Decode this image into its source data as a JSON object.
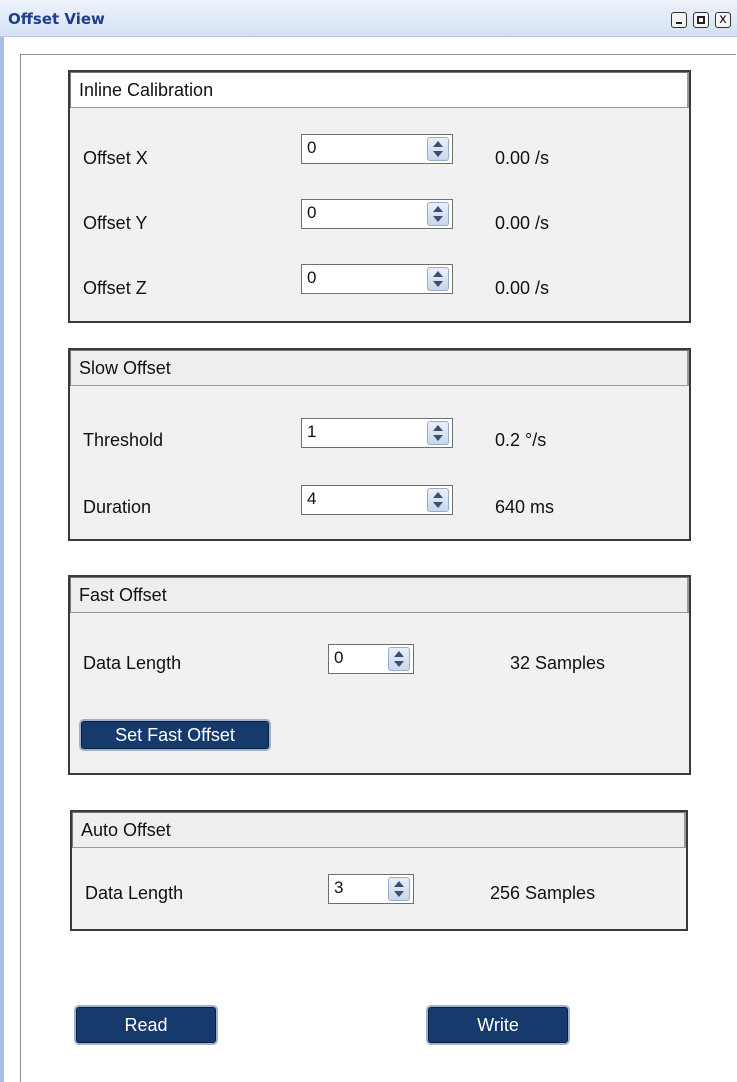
{
  "window": {
    "title": "Offset View",
    "icons": {
      "minimize": "minimize-icon",
      "maximize": "maximize-icon",
      "close": "close-icon"
    },
    "close_glyph": "x"
  },
  "inline_calibration": {
    "header": "Inline Calibration",
    "rows": [
      {
        "label": "Offset X",
        "value": "0",
        "unit": "0.00 /s"
      },
      {
        "label": "Offset Y",
        "value": "0",
        "unit": "0.00 /s"
      },
      {
        "label": "Offset Z",
        "value": "0",
        "unit": "0.00 /s"
      }
    ]
  },
  "slow_offset": {
    "header": "Slow Offset",
    "threshold": {
      "label": "Threshold",
      "value": "1",
      "unit": "0.2 °/s"
    },
    "duration": {
      "label": "Duration",
      "value": "4",
      "unit": "640 ms"
    }
  },
  "fast_offset": {
    "header": "Fast Offset",
    "data_length": {
      "label": "Data Length",
      "value": "0",
      "unit": "32 Samples"
    },
    "set_button": "Set Fast Offset"
  },
  "auto_offset": {
    "header": "Auto Offset",
    "data_length": {
      "label": "Data Length",
      "value": "3",
      "unit": "256 Samples"
    }
  },
  "actions": {
    "read": "Read",
    "write": "Write"
  },
  "colors": {
    "button_navy": "#163a6c",
    "title_text": "#1f3f8a",
    "group_bg": "#f1f1f1"
  }
}
